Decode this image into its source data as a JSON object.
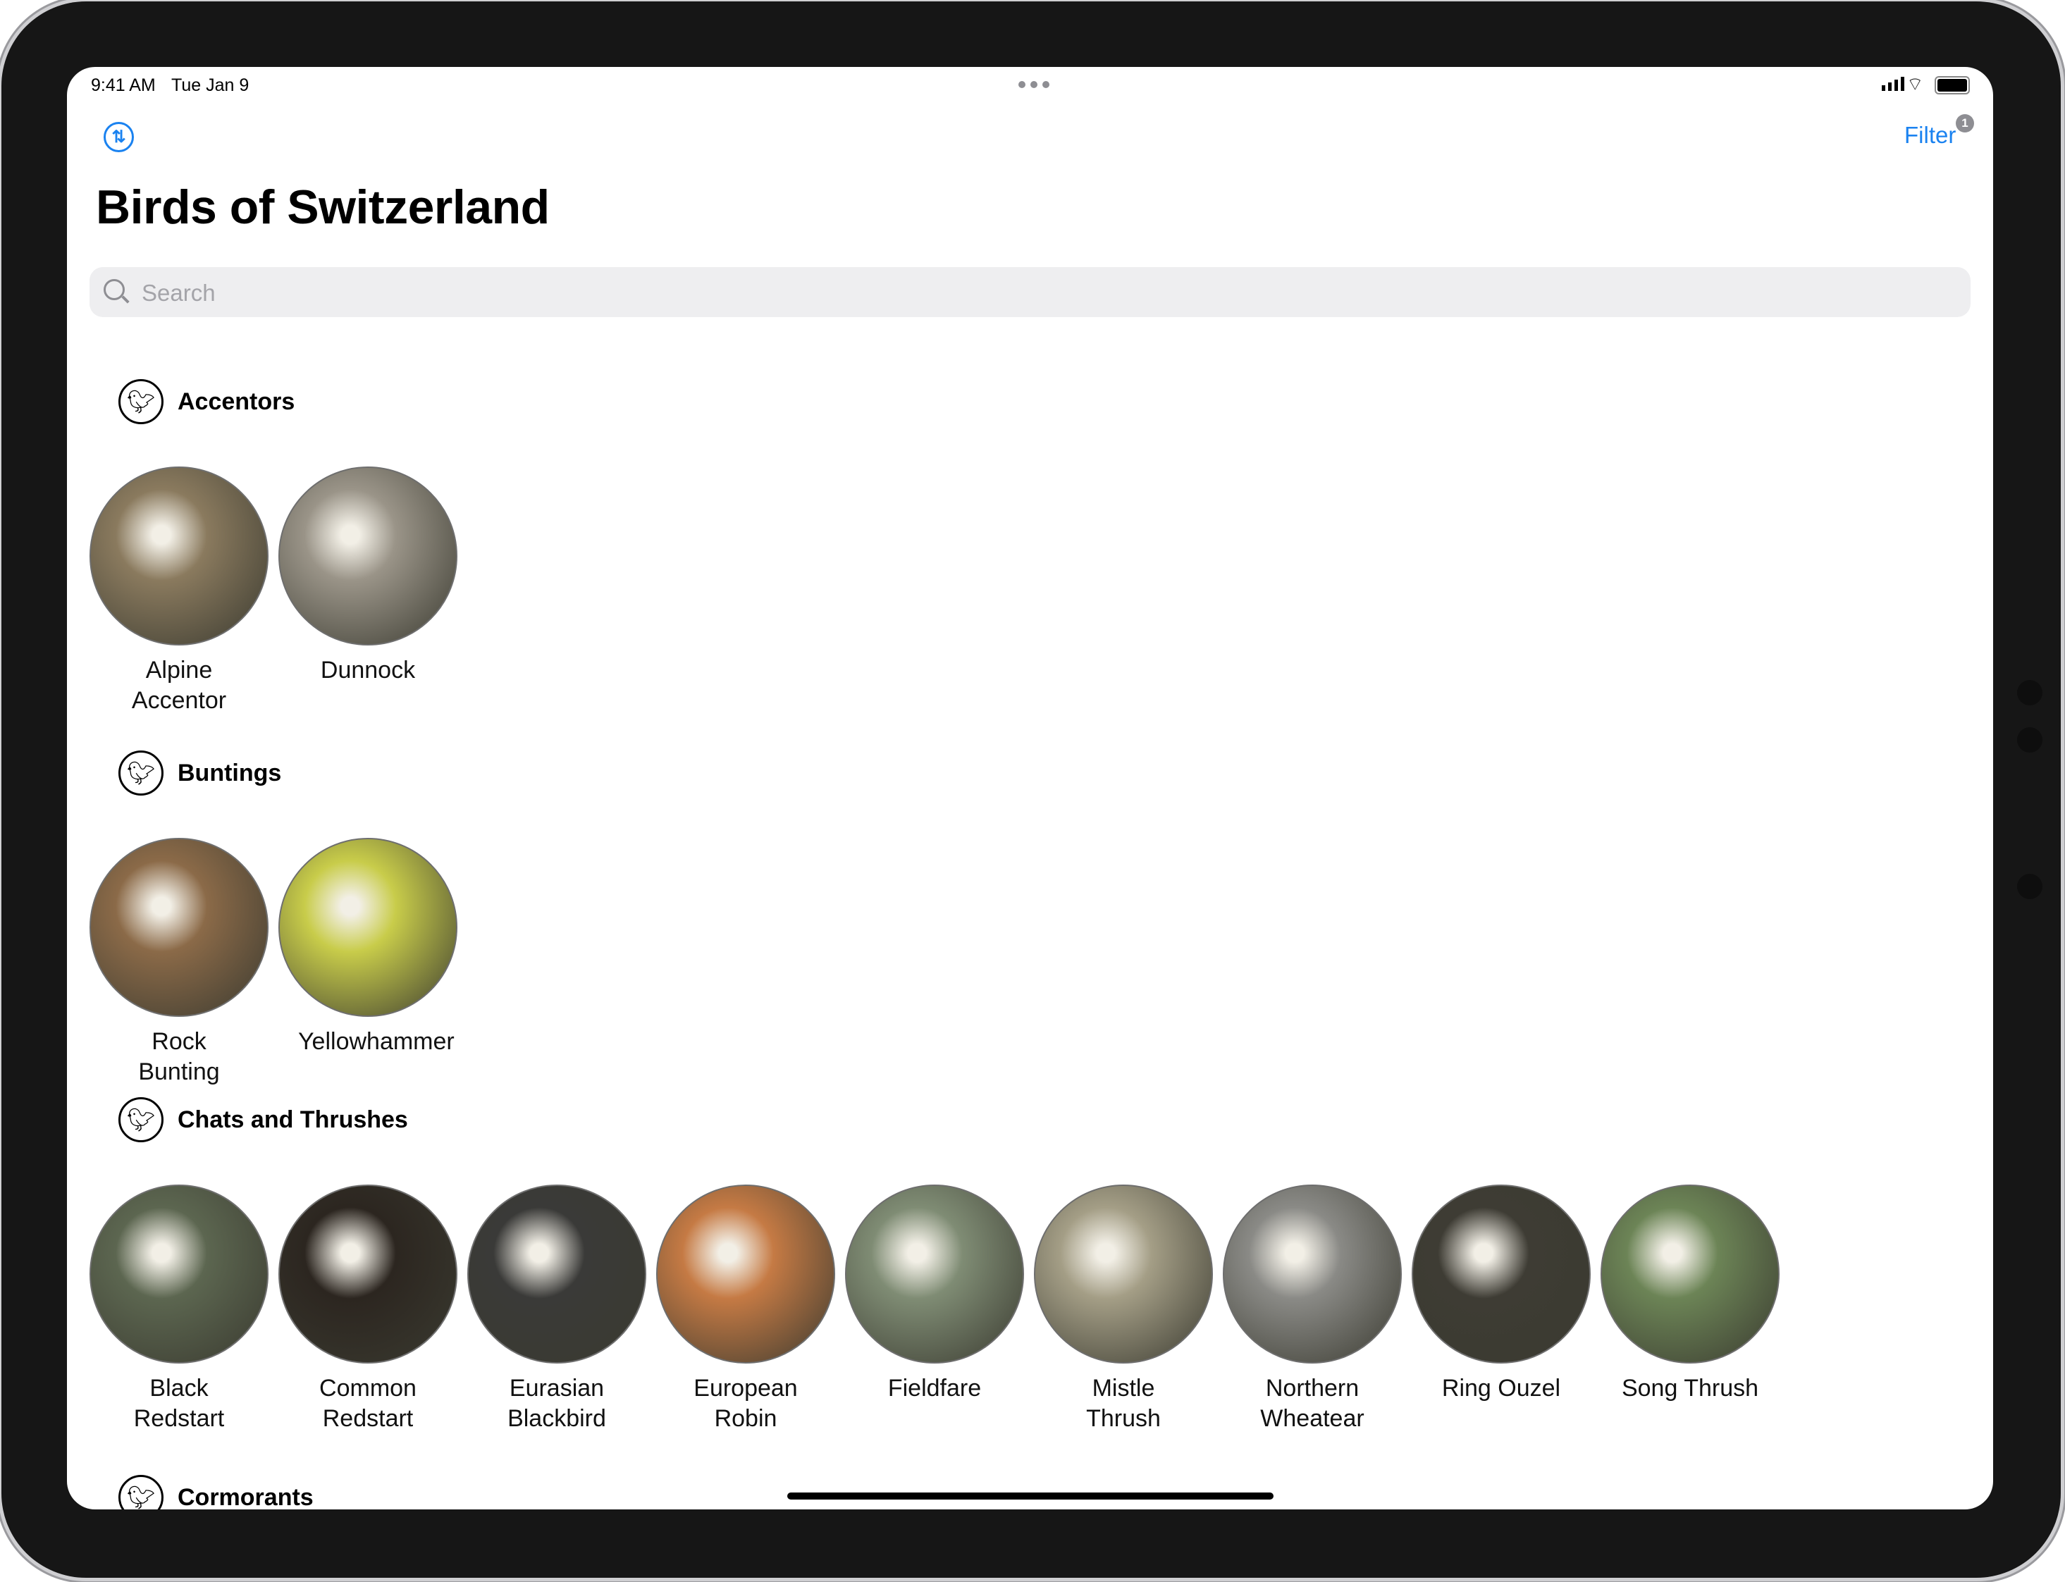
{
  "status_bar": {
    "time": "9:41 AM",
    "date": "Tue Jan 9"
  },
  "toolbar": {
    "sort_icon": "arrow-up-arrow-down-circle-icon",
    "filter_label": "Filter",
    "filter_badge": "1"
  },
  "title": "Birds of Switzerland",
  "search": {
    "placeholder": "Search",
    "value": ""
  },
  "sections": [
    {
      "label": "Accentors",
      "birds": [
        {
          "name": "Alpine Accentor",
          "color": "#8a7a5e"
        },
        {
          "name": "Dunnock",
          "color": "#9a9488"
        }
      ]
    },
    {
      "label": "Buntings",
      "birds": [
        {
          "name": "Rock Bunting",
          "color": "#8b6a48"
        },
        {
          "name": "Yellowhammer",
          "color": "#c8cc4a"
        }
      ]
    },
    {
      "label": "Chats and Thrushes",
      "birds": [
        {
          "name": "Black Redstart",
          "color": "#5c6650"
        },
        {
          "name": "Common Redstart",
          "color": "#2c2620"
        },
        {
          "name": "Eurasian Blackbird",
          "color": "#3a3a38"
        },
        {
          "name": "European Robin",
          "color": "#c57a44"
        },
        {
          "name": "Fieldfare",
          "color": "#7f8c74"
        },
        {
          "name": "Mistle Thrush",
          "color": "#a49e86"
        },
        {
          "name": "Northern Wheatear",
          "color": "#8a8a86"
        },
        {
          "name": "Ring Ouzel",
          "color": "#3e3c34"
        },
        {
          "name": "Song Thrush",
          "color": "#6c8456"
        }
      ]
    },
    {
      "label": "Cormorants",
      "birds": []
    }
  ]
}
